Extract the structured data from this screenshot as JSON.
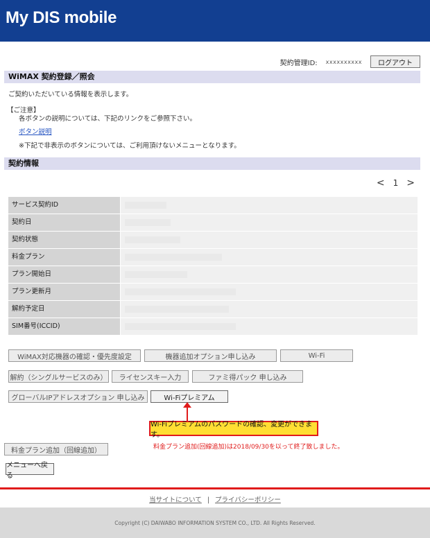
{
  "header": {
    "brand": "My DIS mobile",
    "bg_color": "#123f91"
  },
  "account": {
    "label": "契約管理ID:",
    "id_value": "xxxxxxxxxx",
    "logout_label": "ログアウト"
  },
  "section1": {
    "title": "WiMAX 契約登録／照会",
    "intro": "ご契約いただいている情報を表示します。",
    "notice_heading": "【ご注意】",
    "notice_line": "各ボタンの説明については、下記のリンクをご参照下さい。",
    "link_label": "ボタン説明",
    "note": "※下記で非表示のボタンについては、ご利用頂けないメニューとなります。"
  },
  "section2": {
    "title": "契約情報",
    "pager": {
      "prev": "<",
      "page": "1",
      "next": ">"
    },
    "rows": [
      {
        "label": "サービス契約ID"
      },
      {
        "label": "契約日"
      },
      {
        "label": "契約状態"
      },
      {
        "label": "料金プラン"
      },
      {
        "label": "プラン開始日"
      },
      {
        "label": "プラン更新月"
      },
      {
        "label": "解約予定日"
      },
      {
        "label": "SIM番号(ICCID)"
      }
    ]
  },
  "buttons": {
    "device_check": "WiMAX対応機器の確認・優先度設定",
    "device_add": "機器追加オプション申し込み",
    "wifi": "Wi-Fi",
    "cancel_single": "解約（シングルサービスのみ）",
    "license_key": "ライセンスキー入力",
    "family_pack": "ファミ得パック 申し込み",
    "global_ip": "グローバルIPアドレスオプション 申し込み",
    "wifi_premium": "Wi-Fiプレミアム",
    "plan_add": "料金プラン追加（回線追加）",
    "back_menu": "メニューへ戻る"
  },
  "callout": {
    "text": "Wi-Fiプレミアムのパスワードの確認、変更ができます。",
    "fill_color": "#ffde33",
    "border_color": "#e01b1b"
  },
  "red_note": "料金プラン追加(回線追加)は2018/09/30を以って終了致しました。",
  "footer": {
    "link_about": "当サイトについて",
    "separator": "|",
    "link_privacy": "プライバシーポリシー",
    "copyright": "Copyright (C) DAIWABO INFORMATION SYSTEM CO., LTD. All Rights Reserved."
  },
  "colors": {
    "accent_red": "#e01b1b",
    "section_bg": "#dcdcef"
  }
}
